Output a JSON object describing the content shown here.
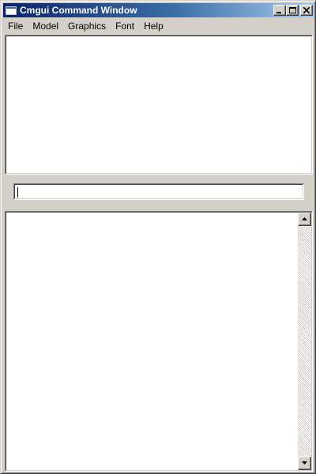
{
  "window": {
    "title": "Cmgui Command Window",
    "title_colors": {
      "start": "#0a246a",
      "end": "#a6caf0"
    }
  },
  "caption_buttons": {
    "minimize_icon": "minimize-icon",
    "maximize_icon": "maximize-icon",
    "close_icon": "close-icon"
  },
  "menubar": {
    "items": [
      {
        "label": "File"
      },
      {
        "label": "Model"
      },
      {
        "label": "Graphics"
      },
      {
        "label": "Font"
      },
      {
        "label": "Help"
      }
    ]
  },
  "history": {
    "lines": []
  },
  "command": {
    "value": "",
    "placeholder": ""
  },
  "output": {
    "lines": []
  },
  "scrollbar": {
    "up_icon": "arrow-up-icon",
    "down_icon": "arrow-down-icon"
  }
}
